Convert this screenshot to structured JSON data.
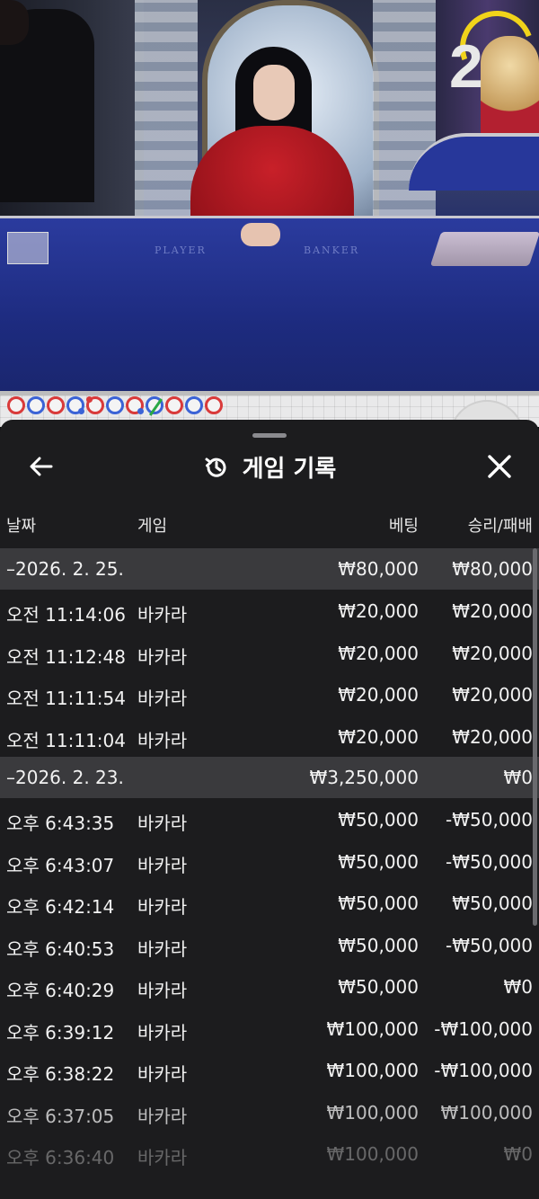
{
  "video": {
    "timer": "2",
    "felt_player": "PLAYER",
    "felt_banker": "BANKER"
  },
  "road": {
    "beads": [
      {
        "color": "red"
      },
      {
        "color": "blue"
      },
      {
        "color": "red"
      },
      {
        "color": "blue",
        "mark": "dot"
      },
      {
        "color": "red",
        "mark": "dotr"
      },
      {
        "color": "blue"
      },
      {
        "color": "red",
        "mark": "dot"
      },
      {
        "color": "blue",
        "mark": "slash"
      },
      {
        "color": "red"
      },
      {
        "color": "blue"
      },
      {
        "color": "red"
      }
    ]
  },
  "sheet": {
    "title": "게임 기록",
    "icons": {
      "back": "arrow-left-icon",
      "history": "history-icon",
      "close": "close-icon"
    },
    "columns": {
      "date": "날짜",
      "game": "게임",
      "bet": "베팅",
      "result": "승리/패배"
    },
    "groups": [
      {
        "date": "–2026. 2. 25.",
        "bet": "₩80,000",
        "result": "₩80,000",
        "rows": [
          {
            "time": "오전 11:14:06",
            "game": "바카라",
            "bet": "₩20,000",
            "result": "₩20,000"
          },
          {
            "time": "오전 11:12:48",
            "game": "바카라",
            "bet": "₩20,000",
            "result": "₩20,000"
          },
          {
            "time": "오전 11:11:54",
            "game": "바카라",
            "bet": "₩20,000",
            "result": "₩20,000"
          },
          {
            "time": "오전 11:11:04",
            "game": "바카라",
            "bet": "₩20,000",
            "result": "₩20,000"
          }
        ]
      },
      {
        "date": "–2026. 2. 23.",
        "bet": "₩3,250,000",
        "result": "₩0",
        "rows": [
          {
            "time": "오후 6:43:35",
            "game": "바카라",
            "bet": "₩50,000",
            "result": "-₩50,000"
          },
          {
            "time": "오후 6:43:07",
            "game": "바카라",
            "bet": "₩50,000",
            "result": "-₩50,000"
          },
          {
            "time": "오후 6:42:14",
            "game": "바카라",
            "bet": "₩50,000",
            "result": "₩50,000"
          },
          {
            "time": "오후 6:40:53",
            "game": "바카라",
            "bet": "₩50,000",
            "result": "-₩50,000"
          },
          {
            "time": "오후 6:40:29",
            "game": "바카라",
            "bet": "₩50,000",
            "result": "₩0"
          },
          {
            "time": "오후 6:39:12",
            "game": "바카라",
            "bet": "₩100,000",
            "result": "-₩100,000"
          },
          {
            "time": "오후 6:38:22",
            "game": "바카라",
            "bet": "₩100,000",
            "result": "-₩100,000"
          },
          {
            "time": "오후 6:37:05",
            "game": "바카라",
            "bet": "₩100,000",
            "result": "₩100,000"
          },
          {
            "time": "오후 6:36:40",
            "game": "바카라",
            "bet": "₩100,000",
            "result": "₩0"
          }
        ]
      }
    ]
  }
}
